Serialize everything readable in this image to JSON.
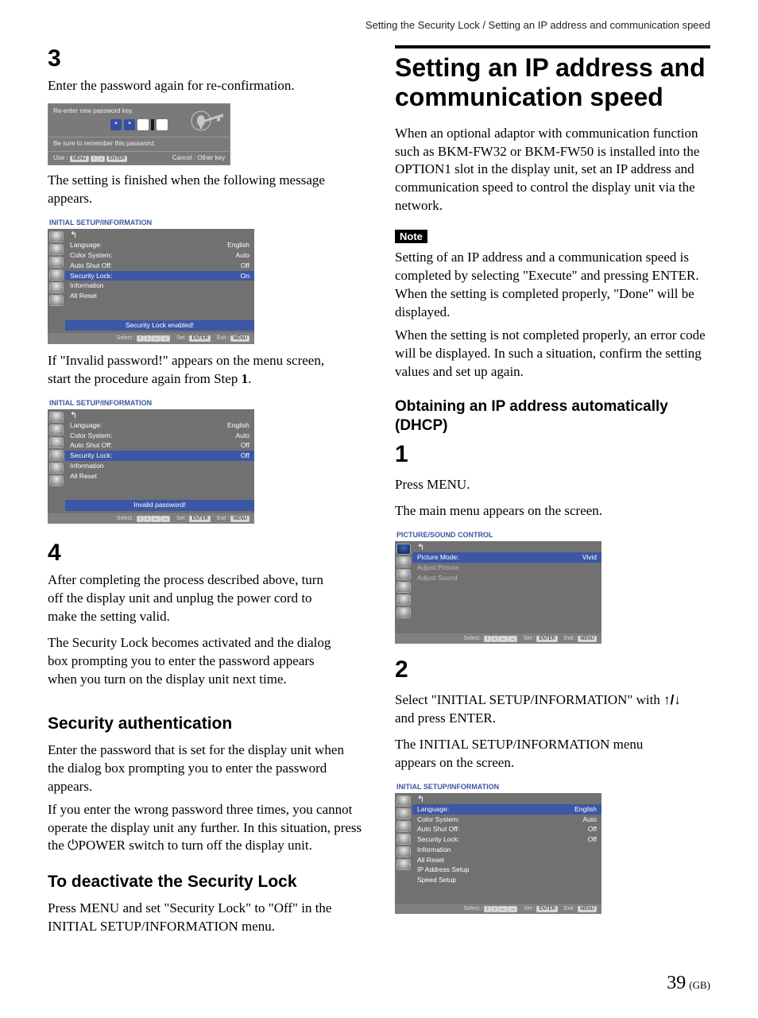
{
  "running_header": "Setting the Security Lock / Setting an IP address and communication speed",
  "page_number": "39",
  "page_suffix": "(GB)",
  "left": {
    "step3": {
      "num": "3",
      "text": "Enter the password again for re-confirmation.",
      "pwpanel": {
        "line1": "Re-enter new password key.",
        "keys": [
          "*",
          "*",
          " ",
          " "
        ],
        "line2": "Be sure to remember this password.",
        "use_prefix": "Use :",
        "cancel": "Cancel  : Other key"
      },
      "after1": "The setting is finished when the following message appears.",
      "osd1": {
        "title": "INITIAL SETUP/INFORMATION",
        "rows": [
          [
            "Language:",
            "English"
          ],
          [
            "Color System:",
            "Auto"
          ],
          [
            "Auto Shut Off:",
            "Off"
          ]
        ],
        "hi": [
          "Security Lock:",
          "On"
        ],
        "tail": [
          "Information",
          "All Reset"
        ],
        "status": "Security Lock enabled!",
        "f1": "Select :",
        "f2": "Set :",
        "f3": "Exit :"
      },
      "after2a": "If \"Invalid password!\" appears on the menu screen, start the procedure again from Step ",
      "after2b": "1",
      "after2c": ".",
      "osd2": {
        "title": "INITIAL SETUP/INFORMATION",
        "rows": [
          [
            "Language:",
            "English"
          ],
          [
            "Color System:",
            "Auto"
          ],
          [
            "Auto Shut Off:",
            "Off"
          ]
        ],
        "hi": [
          "Security Lock:",
          "Off"
        ],
        "tail": [
          "Information",
          "All Reset"
        ],
        "status": "Invalid password!",
        "f1": "Select :",
        "f2": "Set :",
        "f3": "Exit :"
      }
    },
    "step4": {
      "num": "4",
      "p1": "After completing the process described above, turn off the display unit and unplug the power cord to make the setting valid.",
      "p2": "The Security Lock becomes activated and the dialog box prompting you to enter the password appears when you turn on the display unit next time."
    },
    "sec_auth": {
      "heading": "Security authentication",
      "p1": "Enter the password that is set for the display unit when the dialog box prompting you to enter the password appears.",
      "p2a": "If you enter the wrong password three times, you cannot operate the display unit any further. In this situation, press the ",
      "p2b": "POWER switch to turn off the display unit."
    },
    "deact": {
      "heading": "To deactivate the Security Lock",
      "p": "Press MENU and set \"Security Lock\" to \"Off\" in the INITIAL SETUP/INFORMATION menu."
    }
  },
  "right": {
    "title": "Setting an IP address and communication speed",
    "intro": "When an optional adaptor with communication function such as BKM-FW32 or BKM-FW50 is installed into the OPTION1 slot in the display unit, set an IP address and communication speed to control the display unit via the network.",
    "note_label": "Note",
    "note1": "Setting of an IP address and a communication speed is completed by selecting \"Execute\" and pressing ENTER. When the setting is completed properly, \"Done\" will be displayed.",
    "note2": "When the setting is not completed properly, an error code will be displayed. In such a situation, confirm the setting values and set up again.",
    "sub_heading": "Obtaining an IP address automatically (DHCP)",
    "step1": {
      "num": "1",
      "l1": "Press MENU.",
      "l2": "The main menu appears on the screen.",
      "osd": {
        "title": "PICTURE/SOUND CONTROL",
        "hi": [
          "Picture Mode:",
          "Vivid"
        ],
        "dim": [
          "Adjust Picture",
          "Adjust Sound"
        ],
        "f1": "Select :",
        "f2": "Set :",
        "f3": "Exit :"
      }
    },
    "step2": {
      "num": "2",
      "l1a": "Select \"INITIAL SETUP/INFORMATION\" with ",
      "l1b": " and press ENTER.",
      "l2": "The INITIAL SETUP/INFORMATION menu appears on the screen.",
      "osd": {
        "title": "INITIAL SETUP/INFORMATION",
        "hi": [
          "Language:",
          "English"
        ],
        "rows": [
          [
            "Color System:",
            "Auto"
          ],
          [
            "Auto Shut Off:",
            "Off"
          ],
          [
            "Security Lock:",
            "Off"
          ]
        ],
        "tail": [
          "Information",
          "All Reset",
          "IP Address Setup",
          "Speed Setup"
        ],
        "f1": "Select :",
        "f2": "Set :",
        "f3": "Exit :"
      }
    }
  }
}
